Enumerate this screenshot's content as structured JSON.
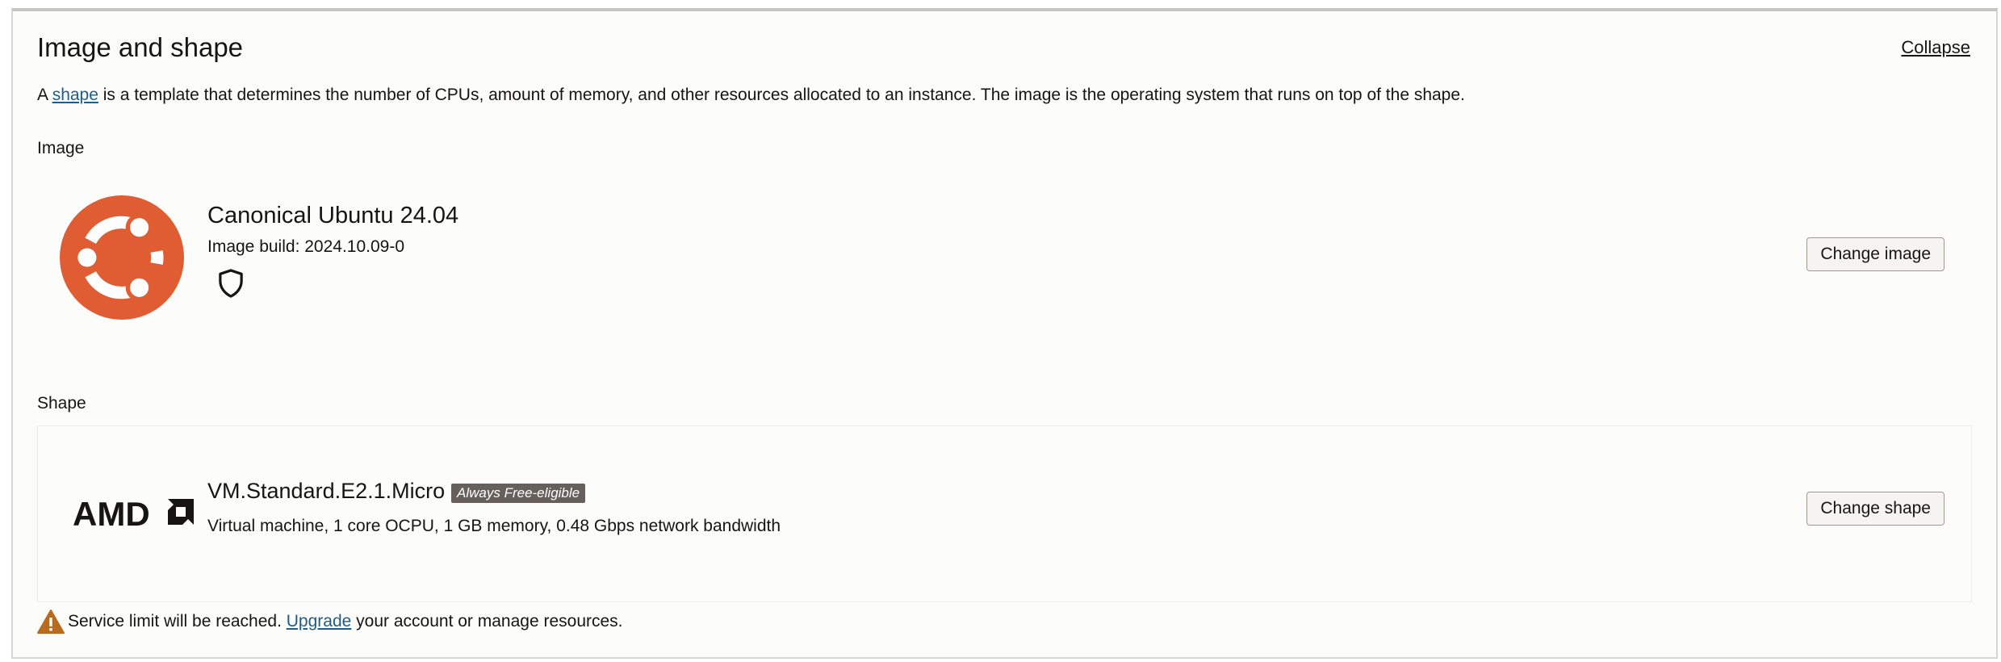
{
  "section": {
    "title": "Image and shape",
    "collapse_label": "Collapse",
    "description": {
      "prefix": "A ",
      "link": "shape",
      "suffix": " is a template that determines the number of CPUs, amount of memory, and other resources allocated to an instance. The image is the operating system that runs on top of the shape."
    }
  },
  "image": {
    "label": "Image",
    "name": "Canonical Ubuntu 24.04",
    "build": "Image build: 2024.10.09-0",
    "icon": "ubuntu-logo",
    "security_icon": "shield-icon",
    "button_label": "Change image"
  },
  "shape": {
    "label": "Shape",
    "name": "VM.Standard.E2.1.Micro",
    "badge": "Always Free-eligible",
    "details": "Virtual machine, 1 core OCPU, 1 GB memory, 0.48 Gbps network bandwidth",
    "vendor_logo": "AMD",
    "button_label": "Change shape"
  },
  "notice": {
    "icon": "warning-icon",
    "prefix": "Service limit will be reached. ",
    "link": "Upgrade",
    "suffix": " your account or manage resources."
  },
  "colors": {
    "ubuntu_orange": "#e05d33",
    "link": "#1e5c8a",
    "badge_bg": "#665f5b",
    "warning": "#b86b1f"
  }
}
